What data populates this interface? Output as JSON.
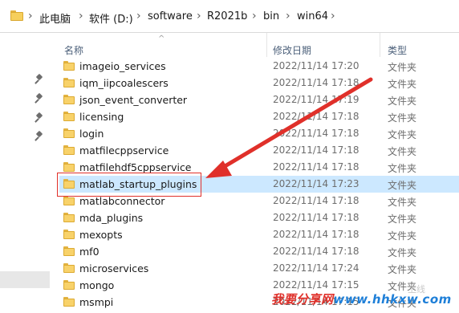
{
  "breadcrumb": {
    "items": [
      "此电脑",
      "软件 (D:)",
      "software",
      "R2021b",
      "bin",
      "win64"
    ],
    "separator": "›"
  },
  "columns": {
    "name": "名称",
    "modified": "修改日期",
    "type": "类型"
  },
  "files": [
    {
      "name": "imageio_services",
      "modified": "2022/11/14 17:20",
      "type": "文件夹"
    },
    {
      "name": "iqm_iipcoalescers",
      "modified": "2022/11/14 17:18",
      "type": "文件夹"
    },
    {
      "name": "json_event_converter",
      "modified": "2022/11/14 17:19",
      "type": "文件夹"
    },
    {
      "name": "licensing",
      "modified": "2022/11/14 17:18",
      "type": "文件夹"
    },
    {
      "name": "login",
      "modified": "2022/11/14 17:18",
      "type": "文件夹"
    },
    {
      "name": "matfilecppservice",
      "modified": "2022/11/14 17:18",
      "type": "文件夹"
    },
    {
      "name": "matfilehdf5cppservice",
      "modified": "2022/11/14 17:18",
      "type": "文件夹"
    },
    {
      "name": "matlab_startup_plugins",
      "modified": "2022/11/14 17:23",
      "type": "文件夹",
      "selected": true
    },
    {
      "name": "matlabconnector",
      "modified": "2022/11/14 17:18",
      "type": "文件夹"
    },
    {
      "name": "mda_plugins",
      "modified": "2022/11/14 17:18",
      "type": "文件夹"
    },
    {
      "name": "mexopts",
      "modified": "2022/11/14 17:18",
      "type": "文件夹"
    },
    {
      "name": "mf0",
      "modified": "2022/11/14 17:18",
      "type": "文件夹"
    },
    {
      "name": "microservices",
      "modified": "2022/11/14 17:24",
      "type": "文件夹"
    },
    {
      "name": "mongo",
      "modified": "2022/11/14 17:15",
      "type": "文件夹"
    },
    {
      "name": "msmpi",
      "modified": "2022/11/14 17:15",
      "type": "文件夹"
    }
  ],
  "watermark": {
    "text": "我要分享网",
    "url": "www.hhkxw.com",
    "faint": "上线"
  },
  "colors": {
    "selection": "#cce8ff",
    "annotation": "#e0302a",
    "folder": "#f8d26a"
  }
}
